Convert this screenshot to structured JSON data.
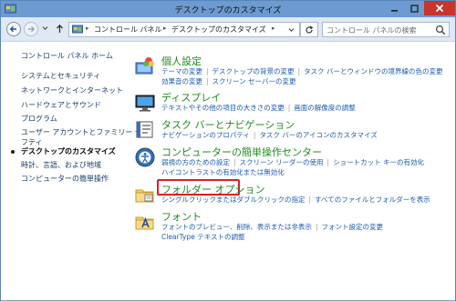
{
  "window": {
    "title": "デスクトップのカスタマイズ"
  },
  "nav": {
    "breadcrumb": [
      "コントロール パネル",
      "デスクトップのカスタマイズ"
    ],
    "search_placeholder": "コントロール パネルの検索"
  },
  "sidebar": {
    "home": "コントロール パネル ホーム",
    "items": [
      {
        "label": "システムとセキュリティ"
      },
      {
        "label": "ネットワークとインターネット"
      },
      {
        "label": "ハードウェアとサウンド"
      },
      {
        "label": "プログラム"
      },
      {
        "label": "ユーザー アカウントとファミリー セー"
      },
      {
        "label": "フティ"
      },
      {
        "label": "デスクトップのカスタマイズ",
        "current": true
      },
      {
        "label": "時計、言語、および地域"
      },
      {
        "label": "コンピューターの簡単操作"
      }
    ]
  },
  "categories": [
    {
      "title": "個人設定",
      "icon": "personalization-icon",
      "lines": [
        [
          "テーマの変更",
          "デスクトップの背景の変更",
          "タスク バーとウィンドウの境界線の色の変更"
        ],
        [
          "効果音の変更",
          "スクリーン セーバーの変更"
        ]
      ]
    },
    {
      "title": "ディスプレイ",
      "icon": "display-icon",
      "lines": [
        [
          "テキストやその他の項目の大きさの変更",
          "画面の解像度の調整"
        ]
      ]
    },
    {
      "title": "タスク バーとナビゲーション",
      "icon": "taskbar-icon",
      "lines": [
        [
          "ナビゲーションのプロパティ",
          "タスク バーのアイコンのカスタマイズ"
        ]
      ]
    },
    {
      "title": "コンピューターの簡単操作センター",
      "icon": "ease-of-access-icon",
      "lines": [
        [
          "弱視の方のための設定",
          "スクリーン リーダーの使用",
          "ショートカット キーの有効化"
        ],
        [
          "ハイコントラストの有効化または無効化"
        ]
      ]
    },
    {
      "title": "フォルダー オプション",
      "icon": "folder-options-icon",
      "lines": [
        [
          "シングルクリックまたはダブルクリックの指定",
          "すべてのファイルとフォルダーを表示"
        ]
      ]
    },
    {
      "title": "フォント",
      "icon": "fonts-icon",
      "lines": [
        [
          "フォントのプレビュー、削除、表示または非表示",
          "フォント設定の変更"
        ],
        [
          "ClearType テキストの調整"
        ]
      ]
    }
  ],
  "colors": {
    "category_title": "#1e8b1e",
    "link": "#1d5ab5",
    "highlight_box": "#e21c22",
    "titlebar": "#6d9bd1",
    "close_button": "#c7352d"
  }
}
